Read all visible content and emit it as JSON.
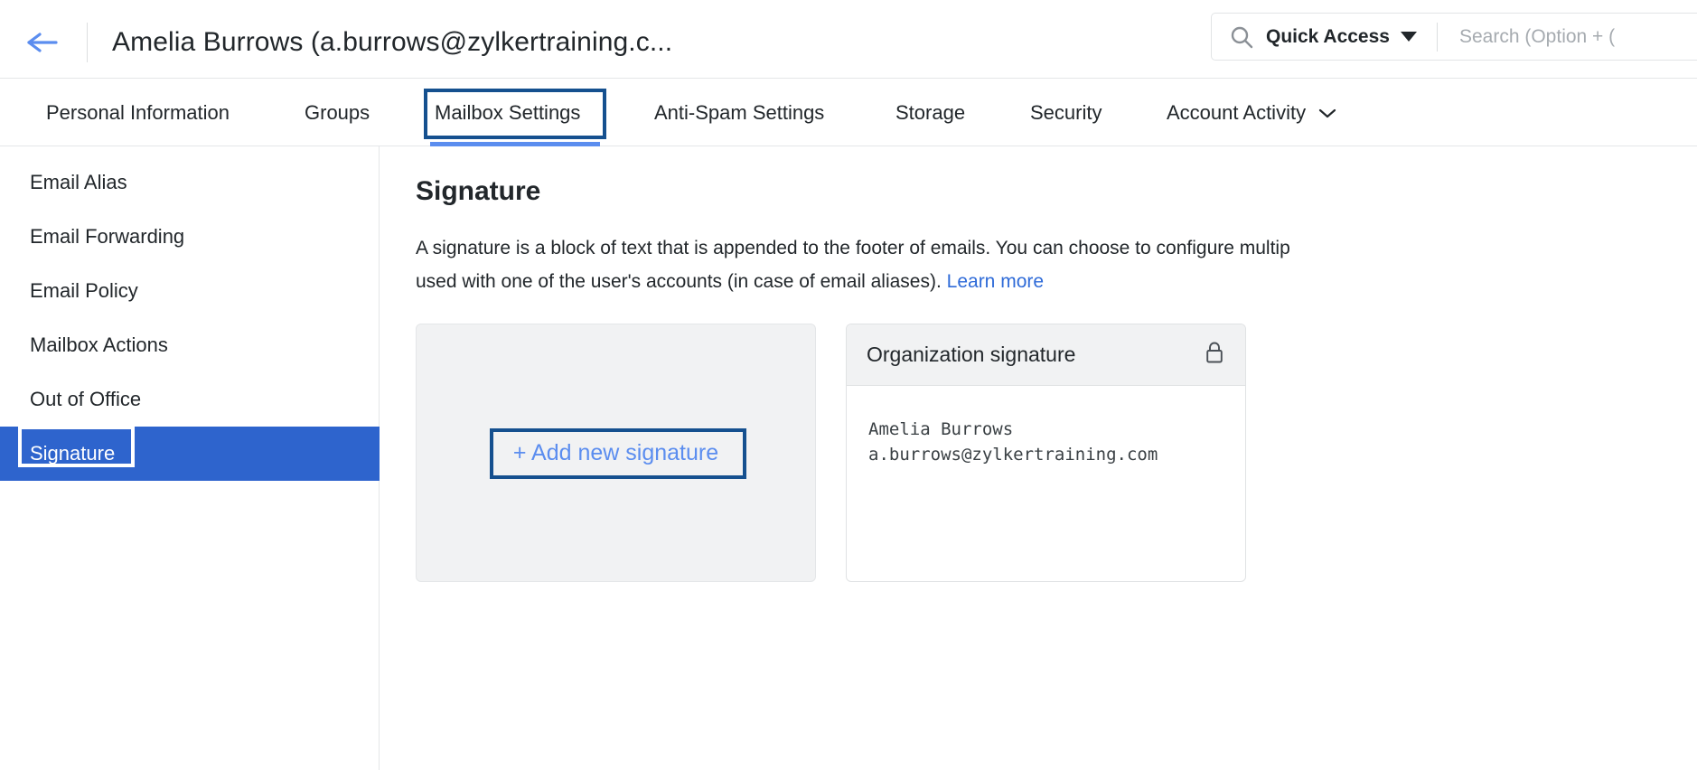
{
  "header": {
    "back_icon": "arrow-left-icon",
    "title": "Amelia Burrows (a.burrows@zylkertraining.c...",
    "search": {
      "icon": "search-icon",
      "scope_label": "Quick Access",
      "scope_caret": "chevron-down-icon",
      "placeholder": "Search (Option + (",
      "value": ""
    }
  },
  "tabs": {
    "items": [
      {
        "label": "Personal Information",
        "active": false
      },
      {
        "label": "Groups",
        "active": false
      },
      {
        "label": "Mailbox Settings",
        "active": true
      },
      {
        "label": "Anti-Spam Settings",
        "active": false
      },
      {
        "label": "Storage",
        "active": false
      },
      {
        "label": "Security",
        "active": false
      },
      {
        "label": "Account Activity",
        "active": false,
        "caret": "chevron-down-icon"
      }
    ]
  },
  "sidebar": {
    "items": [
      {
        "label": "Email Alias",
        "selected": false
      },
      {
        "label": "Email Forwarding",
        "selected": false
      },
      {
        "label": "Email Policy",
        "selected": false
      },
      {
        "label": "Mailbox Actions",
        "selected": false
      },
      {
        "label": "Out of Office",
        "selected": false
      },
      {
        "label": "Signature",
        "selected": true
      }
    ]
  },
  "main": {
    "heading": "Signature",
    "description_line1": "A signature is a block of text that is appended to the footer of emails. You can choose to configure multip",
    "description_line2": "used with one of the user's accounts (in case of email aliases). ",
    "learn_more_label": "Learn more",
    "add_card": {
      "label": "+ Add new signature"
    },
    "org_card": {
      "title": "Organization signature",
      "lock_icon": "lock-icon",
      "body": "Amelia Burrows\na.burrows@zylkertraining.com"
    }
  },
  "colors": {
    "accent_blue": "#5b8def",
    "selected_blue": "#2e64cd",
    "annotation_blue": "#15508f",
    "annotation_white": "#ffffff",
    "link_blue": "#2f6bd8"
  }
}
